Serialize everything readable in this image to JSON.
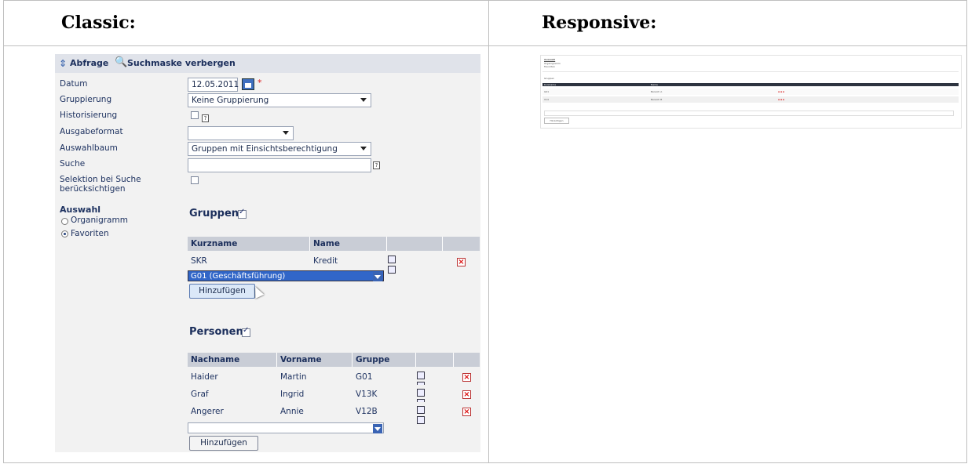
{
  "headers": {
    "classic": "Classic:",
    "responsive": "Responsive:"
  },
  "toolbar": {
    "query_label": "Abfrage",
    "hide_search_label": "Suchmaske verbergen"
  },
  "form": {
    "date_label": "Datum",
    "date_value": "12.05.2011",
    "required_mark": "*",
    "grouping_label": "Gruppierung",
    "grouping_value": "Keine Gruppierung",
    "history_label": "Historisierung",
    "output_label": "Ausgabeformat",
    "output_value": "",
    "tree_label": "Auswahlbaum",
    "tree_value": "Gruppen mit Einsichtsberechtigung",
    "search_label": "Suche",
    "search_value": "",
    "selection_label": "Selektion bei Suche berücksichtigen"
  },
  "selection": {
    "title": "Auswahl",
    "options": [
      "Organigramm",
      "Favoriten"
    ],
    "selected": "Favoriten"
  },
  "groups": {
    "title": "Gruppen",
    "columns": [
      "Kurzname",
      "Name"
    ],
    "rows": [
      {
        "kurzname": "SKR",
        "name": "Kredit"
      }
    ],
    "dropdown_value": "G01 (Geschäftsführung)",
    "add_label": "Hinzufügen"
  },
  "persons": {
    "title": "Personen",
    "columns": [
      "Nachname",
      "Vorname",
      "Gruppe"
    ],
    "rows": [
      {
        "nachname": "Haider",
        "vorname": "Martin",
        "gruppe": "G01"
      },
      {
        "nachname": "Graf",
        "vorname": "Ingrid",
        "gruppe": "V13K"
      },
      {
        "nachname": "Angerer",
        "vorname": "Annie",
        "gruppe": "V12B"
      }
    ],
    "dropdown_value": "",
    "add_label": "Hinzufügen"
  },
  "responsive": {
    "title": "Auswahl",
    "options": [
      "Organigramm",
      "Favoriten"
    ],
    "group_heading": "Gruppen",
    "columns": [
      "Kurzname",
      "Name"
    ],
    "rows": [
      {
        "kurzname": "G01",
        "name": "Bereich A"
      },
      {
        "kurzname": "V14",
        "name": "Bereich B"
      }
    ],
    "add_label": "Hinzufügen"
  }
}
